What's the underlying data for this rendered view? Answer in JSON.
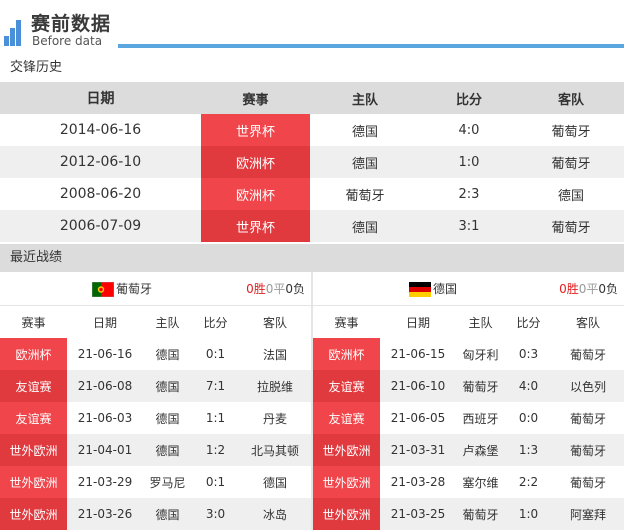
{
  "header": {
    "title": "赛前数据",
    "subtitle": "Before data"
  },
  "history": {
    "section_title": "交锋历史",
    "columns": [
      "日期",
      "赛事",
      "主队",
      "比分",
      "客队"
    ],
    "rows": [
      {
        "date": "2014-06-16",
        "event": "世界杯",
        "home": "德国",
        "score": "4:0",
        "away": "葡萄牙"
      },
      {
        "date": "2012-06-10",
        "event": "欧洲杯",
        "home": "德国",
        "score": "1:0",
        "away": "葡萄牙"
      },
      {
        "date": "2008-06-20",
        "event": "欧洲杯",
        "home": "葡萄牙",
        "score": "2:3",
        "away": "德国"
      },
      {
        "date": "2006-07-09",
        "event": "世界杯",
        "home": "德国",
        "score": "3:1",
        "away": "葡萄牙"
      }
    ]
  },
  "recent": {
    "section_title": "最近战绩",
    "columns": [
      "赛事",
      "日期",
      "主队",
      "比分",
      "客队"
    ],
    "left": {
      "team": "葡萄牙",
      "wins": "0胜",
      "draws": "0平",
      "losses": "0负",
      "flag_colors": {
        "green": "#006600",
        "red": "#ff0000",
        "gold": "#ffcc00"
      },
      "rows": [
        {
          "event": "欧洲杯",
          "date": "21-06-16",
          "home": "德国",
          "score": "0:1",
          "away": "法国"
        },
        {
          "event": "友谊赛",
          "date": "21-06-08",
          "home": "德国",
          "score": "7:1",
          "away": "拉脱维"
        },
        {
          "event": "友谊赛",
          "date": "21-06-03",
          "home": "德国",
          "score": "1:1",
          "away": "丹麦"
        },
        {
          "event": "世外欧洲",
          "date": "21-04-01",
          "home": "德国",
          "score": "1:2",
          "away": "北马其顿"
        },
        {
          "event": "世外欧洲",
          "date": "21-03-29",
          "home": "罗马尼",
          "score": "0:1",
          "away": "德国"
        },
        {
          "event": "世外欧洲",
          "date": "21-03-26",
          "home": "德国",
          "score": "3:0",
          "away": "冰岛"
        }
      ]
    },
    "right": {
      "team": "德国",
      "wins": "0胜",
      "draws": "0平",
      "losses": "0负",
      "flag_colors": {
        "black": "#000000",
        "red": "#dd0000",
        "gold": "#ffce00"
      },
      "rows": [
        {
          "event": "欧洲杯",
          "date": "21-06-15",
          "home": "匈牙利",
          "score": "0:3",
          "away": "葡萄牙"
        },
        {
          "event": "友谊赛",
          "date": "21-06-10",
          "home": "葡萄牙",
          "score": "4:0",
          "away": "以色列"
        },
        {
          "event": "友谊赛",
          "date": "21-06-05",
          "home": "西班牙",
          "score": "0:0",
          "away": "葡萄牙"
        },
        {
          "event": "世外欧洲",
          "date": "21-03-31",
          "home": "卢森堡",
          "score": "1:3",
          "away": "葡萄牙"
        },
        {
          "event": "世外欧洲",
          "date": "21-03-28",
          "home": "塞尔维",
          "score": "2:2",
          "away": "葡萄牙"
        },
        {
          "event": "世外欧洲",
          "date": "21-03-25",
          "home": "葡萄牙",
          "score": "1:0",
          "away": "阿塞拜"
        }
      ]
    }
  },
  "colors": {
    "accent": "#5aa6de",
    "event_tag": "#f0454a",
    "win": "#e02020"
  }
}
